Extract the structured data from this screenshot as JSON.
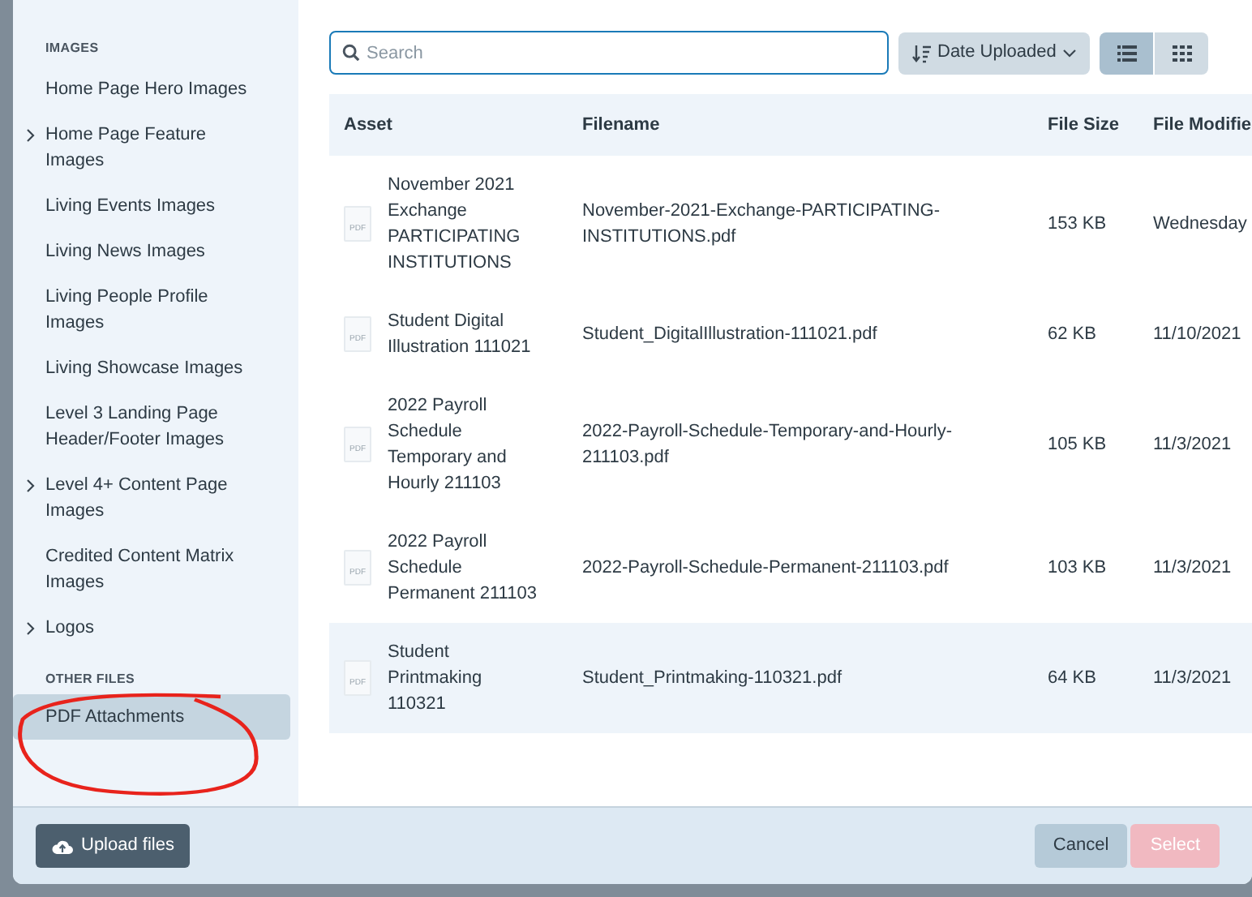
{
  "sidebar": {
    "items": [
      {
        "kind": "heading",
        "label": "IMAGES"
      },
      {
        "kind": "item",
        "label": "Home Page Hero Images",
        "expandable": false,
        "selected": false
      },
      {
        "kind": "item",
        "label": "Home Page Feature Images",
        "expandable": true,
        "selected": false
      },
      {
        "kind": "item",
        "label": "Living Events Images",
        "expandable": false,
        "selected": false
      },
      {
        "kind": "item",
        "label": "Living News Images",
        "expandable": false,
        "selected": false
      },
      {
        "kind": "item",
        "label": "Living People Profile Images",
        "expandable": false,
        "selected": false
      },
      {
        "kind": "item",
        "label": "Living Showcase Images",
        "expandable": false,
        "selected": false
      },
      {
        "kind": "item",
        "label": "Level 3 Landing Page Header/Footer Images",
        "expandable": false,
        "selected": false
      },
      {
        "kind": "item",
        "label": "Level 4+ Content Page Images",
        "expandable": true,
        "selected": false
      },
      {
        "kind": "item",
        "label": "Credited Content Matrix Images",
        "expandable": false,
        "selected": false
      },
      {
        "kind": "item",
        "label": "Logos",
        "expandable": true,
        "selected": false
      },
      {
        "kind": "heading",
        "label": "OTHER FILES"
      },
      {
        "kind": "item",
        "label": "PDF Attachments",
        "expandable": false,
        "selected": true
      }
    ]
  },
  "search": {
    "placeholder": "Search"
  },
  "sort": {
    "label": "Date Uploaded"
  },
  "view_toggles": [
    {
      "kind": "list",
      "selected": true
    },
    {
      "kind": "grid",
      "selected": false
    }
  ],
  "table": {
    "columns": [
      "Asset",
      "Filename",
      "File Size",
      "File Modifie"
    ],
    "rows": [
      {
        "icon_label": "PDF",
        "asset": "November 2021 Exchange PARTICIPATING INSTITUTIONS",
        "filename": "November-2021-Exchange-PARTICIPATING-INSTITUTIONS.pdf",
        "size": "153 KB",
        "modified": "Wednesday",
        "selected": false
      },
      {
        "icon_label": "PDF",
        "asset": "Student Digital Illustration 111021",
        "filename": "Student_DigitalIllustration-111021.pdf",
        "size": "62 KB",
        "modified": "11/10/2021",
        "selected": false
      },
      {
        "icon_label": "PDF",
        "asset": "2022 Payroll Schedule Temporary and Hourly 211103",
        "filename": "2022-Payroll-Schedule-Temporary-and-Hourly-211103.pdf",
        "size": "105 KB",
        "modified": "11/3/2021",
        "selected": false
      },
      {
        "icon_label": "PDF",
        "asset": "2022 Payroll Schedule Permanent 211103",
        "filename": "2022-Payroll-Schedule-Permanent-211103.pdf",
        "size": "103 KB",
        "modified": "11/3/2021",
        "selected": false
      },
      {
        "icon_label": "PDF",
        "asset": "Student Printmaking 110321",
        "filename": "Student_Printmaking-110321.pdf",
        "size": "64 KB",
        "modified": "11/3/2021",
        "selected": true
      }
    ]
  },
  "footer": {
    "upload": {
      "label": "Upload files"
    },
    "cancel": {
      "label": "Cancel"
    },
    "select": {
      "label": "Select",
      "disabled": true
    }
  }
}
